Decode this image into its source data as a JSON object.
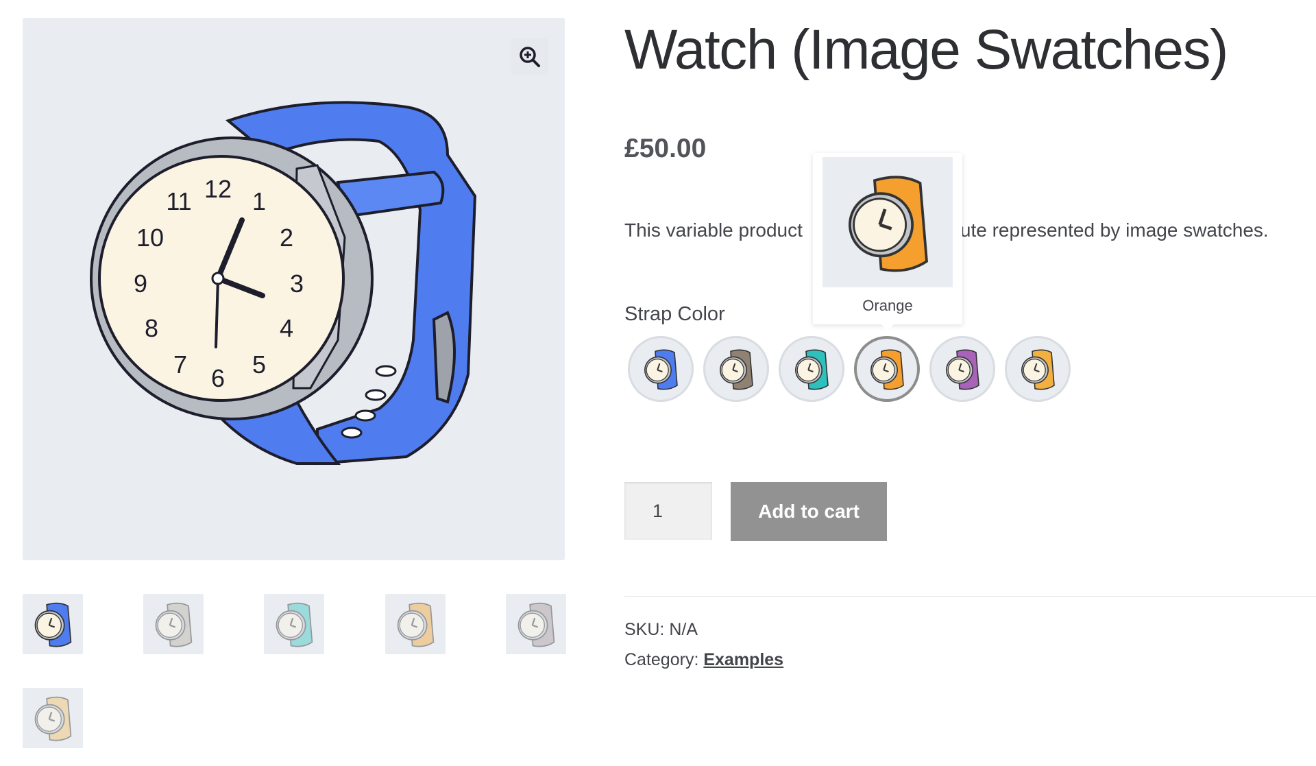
{
  "product": {
    "title": "Watch (Image Swatches)",
    "price": "£50.00",
    "description_left": "This variable product",
    "description_right": "ute represented by image swatches."
  },
  "gallery": {
    "zoom_icon": "zoom-in-icon",
    "main_image_color": "#4f7df0",
    "thumbnails": [
      {
        "strap_color": "#4f7df0",
        "active": true
      },
      {
        "strap_color": "#b9b2a6",
        "active": false
      },
      {
        "strap_color": "#3ec7c2",
        "active": false
      },
      {
        "strap_color": "#f2a83a",
        "active": false
      },
      {
        "strap_color": "#a79a9e",
        "active": false
      },
      {
        "strap_color": "#f2c26a",
        "active": false
      }
    ]
  },
  "attribute": {
    "label": "Strap Color",
    "swatches": [
      {
        "strap_color": "#4f7df0",
        "selected": false
      },
      {
        "strap_color": "#8f8272",
        "selected": false
      },
      {
        "strap_color": "#2fbfbd",
        "selected": false
      },
      {
        "strap_color": "#f5a02e",
        "selected": true
      },
      {
        "strap_color": "#a862b8",
        "selected": false
      },
      {
        "strap_color": "#f2b041",
        "selected": false
      }
    ],
    "tooltip": {
      "label": "Orange",
      "strap_color": "#f5a02e"
    }
  },
  "cart": {
    "quantity": "1",
    "add_to_cart_label": "Add to cart"
  },
  "meta": {
    "sku_label": "SKU:",
    "sku_value": "N/A",
    "category_label": "Category:",
    "category_value": "Examples"
  },
  "colors": {
    "button_bg": "#929292",
    "image_bg": "#e9edf2"
  }
}
